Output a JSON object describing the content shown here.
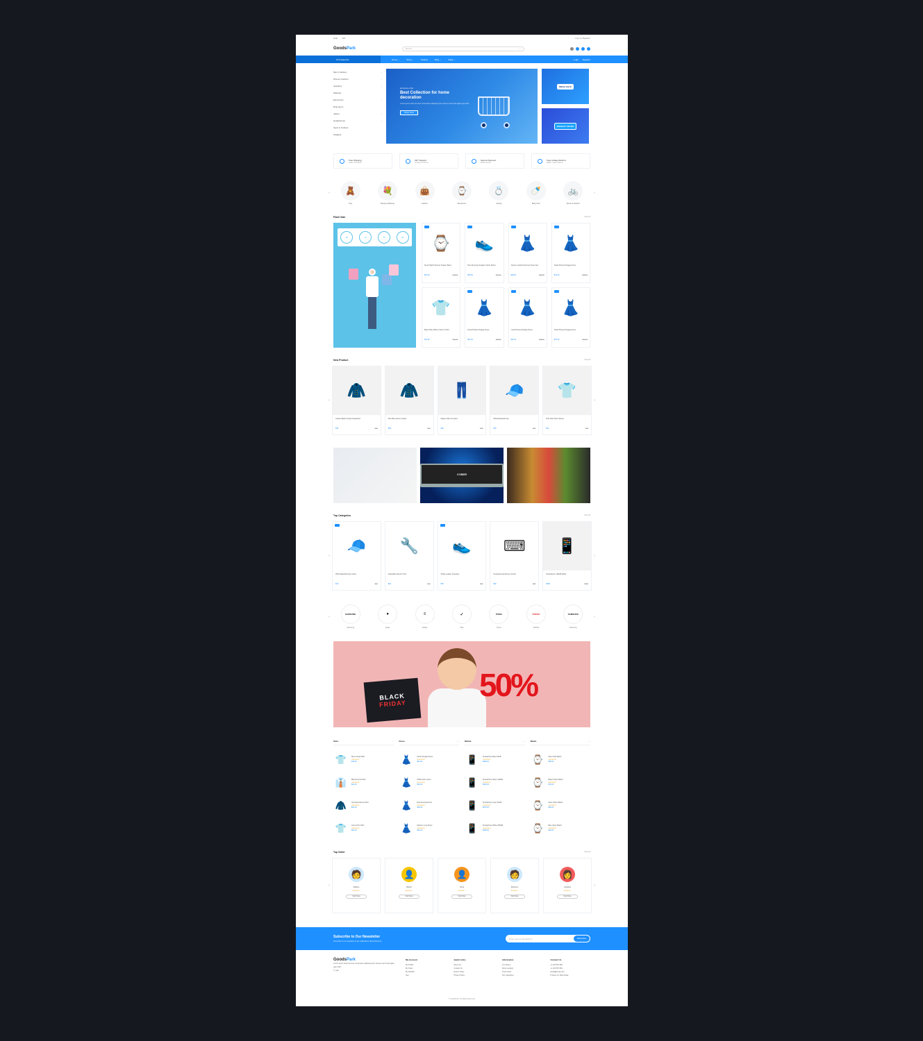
{
  "topbar": {
    "left": [
      "Help",
      "EN"
    ],
    "right": "Log In | Register"
  },
  "header": {
    "logo_a": "Goods",
    "logo_b": "Park",
    "search_placeholder": "Search"
  },
  "nav": {
    "all_categories": "All Categories",
    "links": [
      "Home ⌄",
      "Shop ⌄",
      "Product",
      "Blog ⌄",
      "Page ⌄"
    ],
    "right": [
      "Login",
      "Register"
    ]
  },
  "sidebar_categories": [
    "Men's Fashion",
    "Women Fashion",
    "Jewellery",
    "Watches",
    "Electronics",
    "Ring Items",
    "Jacket",
    "Headphones",
    "Sport & Outdoor",
    "Gadgets"
  ],
  "hero": {
    "small": "Exclusive offer",
    "title": "Best Collection for home decoration",
    "desc": "Lorem ipsum dolor sit amet consectetur adipiscing elit. Aenean commodo ligula eget dolor.",
    "button": "Shop Now",
    "side1": "MEGA SALE",
    "side2": "BIGGEST OFFER"
  },
  "features": [
    {
      "t": "Free Shipping",
      "s": "Order over $100"
    },
    {
      "t": "24/7 Support",
      "s": "Contact us 24 hrs"
    },
    {
      "t": "Secure Payment",
      "s": "100% secure"
    },
    {
      "t": "Free & Easy Returns",
      "s": "Within 7 days returns"
    }
  ],
  "categories": [
    {
      "icon": "🧸",
      "label": "Toys"
    },
    {
      "icon": "💐",
      "label": "Beauty & Makeup"
    },
    {
      "icon": "👜",
      "label": "Fashion"
    },
    {
      "icon": "⌚",
      "label": "Electronics"
    },
    {
      "icon": "💍",
      "label": "Jewelry"
    },
    {
      "icon": "🍼",
      "label": "Baby Care"
    },
    {
      "icon": "🚲",
      "label": "Sports & Outdoor"
    }
  ],
  "flash": {
    "title": "Flash Sale",
    "more": "View All",
    "timer": [
      "00",
      "12",
      "45",
      "30"
    ],
    "products": [
      {
        "icon": "⌚",
        "name": "Smart Watch Fitness Tracker Band",
        "price": "$23.00",
        "old": "$27.00"
      },
      {
        "icon": "👟",
        "name": "Men Running Sneakers Sport Shoes",
        "price": "$36.00",
        "old": "$42.00"
      },
      {
        "icon": "👗",
        "name": "Women Colorful Summer Dress Set",
        "price": "$28.00",
        "old": "$35.00"
      },
      {
        "icon": "👗",
        "name": "Floral Printed Vintage Dress",
        "price": "$31.00",
        "old": "$38.00"
      },
      {
        "icon": "👕",
        "name": "Basic Plain White Cotton T-Shirt",
        "price": "$12.00",
        "old": "$16.00"
      },
      {
        "icon": "👗",
        "name": "Floral Printed Vintage Dress",
        "price": "$31.00",
        "old": "$38.00"
      },
      {
        "icon": "👗",
        "name": "Floral Printed Vintage Dress",
        "price": "$31.00",
        "old": "$38.00"
      },
      {
        "icon": "👗",
        "name": "Floral Printed Vintage Dress",
        "price": "$31.00",
        "old": "$38.00"
      }
    ]
  },
  "new_products": {
    "title": "New Product",
    "more": "View All",
    "items": [
      {
        "icon": "🧥",
        "name": "Classic Black Hoodie Sweatshirt",
        "price": "$45",
        "old": "$52"
      },
      {
        "icon": "🧥",
        "name": "Men Blue Denim Jacket",
        "price": "$58",
        "old": "$66"
      },
      {
        "icon": "👖",
        "name": "Ripped Slim Fit Jeans",
        "price": "$40",
        "old": "$48"
      },
      {
        "icon": "🧢",
        "name": "White Baseball Cap",
        "price": "$15",
        "old": "$19"
      },
      {
        "icon": "👕",
        "name": "Polo Shirt Short Sleeve",
        "price": "$22",
        "old": "$28"
      }
    ]
  },
  "promos": {
    "p2_text": "CYBER"
  },
  "top_categories": {
    "title": "Top Categories",
    "more": "View All",
    "items": [
      {
        "icon": "🧢",
        "name": "White Baseball Cap Unisex",
        "price": "$15",
        "old": "$19"
      },
      {
        "icon": "🔧",
        "name": "Adjustable Wrench Tool",
        "price": "$18",
        "old": "$22"
      },
      {
        "icon": "👟",
        "name": "White Leather Sneakers",
        "price": "$54",
        "old": "$60"
      },
      {
        "icon": "⌨",
        "name": "Keyboard and Mouse Combo",
        "price": "$29",
        "old": "$35"
      },
      {
        "icon": "📱",
        "name": "Smartphone 128GB White",
        "price": "$399",
        "old": "$450"
      }
    ]
  },
  "brands": [
    {
      "logo": "SAMSUNG",
      "label": "Samsung"
    },
    {
      "logo": "",
      "label": "Apple"
    },
    {
      "logo": "≡",
      "label": "Adidas"
    },
    {
      "logo": "✓",
      "label": "Nike"
    },
    {
      "logo": "PUMA",
      "label": "Puma"
    },
    {
      "logo": "TOSHIBA",
      "label": "Toshiba"
    },
    {
      "logo": "SAMSUNG",
      "label": "Samsung"
    }
  ],
  "big_promo": {
    "line1": "BLACK",
    "line2": "FRIDAY",
    "pct": "50%"
  },
  "columns": [
    {
      "title": "Shirt",
      "items": [
        {
          "icon": "👕",
          "name": "Men Casual Shirt",
          "price": "$18.00"
        },
        {
          "icon": "👔",
          "name": "Black Formal Shirt",
          "price": "$22.00"
        },
        {
          "icon": "🧥",
          "name": "Checked Flannel Shirt",
          "price": "$24.00"
        },
        {
          "icon": "👕",
          "name": "Camo Print Shirt",
          "price": "$20.00"
        }
      ]
    },
    {
      "title": "Dress",
      "items": [
        {
          "icon": "👗",
          "name": "Floral Vintage Dress",
          "price": "$31.00"
        },
        {
          "icon": "👗",
          "name": "White Party Gown",
          "price": "$45.00"
        },
        {
          "icon": "👗",
          "name": "Red Evening Dress",
          "price": "$39.00"
        },
        {
          "icon": "👗",
          "name": "Maroon Long Dress",
          "price": "$42.00"
        }
      ]
    },
    {
      "title": "Mobile",
      "items": [
        {
          "icon": "📱",
          "name": "Smartphone Blue 64GB",
          "price": "$299.00"
        },
        {
          "icon": "📱",
          "name": "Smartphone Silver 128GB",
          "price": "$349.00"
        },
        {
          "icon": "📱",
          "name": "Smartphone Cyan 64GB",
          "price": "$279.00"
        },
        {
          "icon": "📱",
          "name": "Smartphone White 256GB",
          "price": "$399.00"
        }
      ]
    },
    {
      "title": "Watch",
      "items": [
        {
          "icon": "⌚",
          "name": "Silver Dial Watch",
          "price": "$59.00"
        },
        {
          "icon": "⌚",
          "name": "Black Smart Watch",
          "price": "$79.00"
        },
        {
          "icon": "⌚",
          "name": "Steel Chain Watch",
          "price": "$69.00"
        },
        {
          "icon": "⌚",
          "name": "Blue Sport Watch",
          "price": "$49.00"
        }
      ]
    }
  ],
  "sellers": {
    "title": "Top Seller",
    "more": "View All",
    "visit": "Visit Store",
    "items": [
      {
        "icon": "🧑",
        "bg": "#cde8fb",
        "name": "Mathew"
      },
      {
        "icon": "👤",
        "bg": "#f7c600",
        "name": "Rachel"
      },
      {
        "icon": "👤",
        "bg": "#f7941d",
        "name": "Hena"
      },
      {
        "icon": "🧑",
        "bg": "#cde8fb",
        "name": "Robinson"
      },
      {
        "icon": "👩",
        "bg": "#f25c5c",
        "name": "Angelina"
      }
    ]
  },
  "newsletter": {
    "title": "Subscribe to Our Newsletter",
    "sub": "Subscribe to our newsletter to get notifications about discounts",
    "placeholder": "Enter your email address",
    "button": "Subscribe"
  },
  "footer": {
    "about": "Lorem ipsum dolor sit amet consectetur adipiscing elit. Aenean commodo ligula eget dolor.",
    "cols": [
      {
        "h": "My Account",
        "items": [
          "My Profile",
          "My Order",
          "My Wishlist",
          "Cart"
        ]
      },
      {
        "h": "Quick Links",
        "items": [
          "About Us",
          "Contact Us",
          "Return Policy",
          "Privacy Policy"
        ]
      },
      {
        "h": "Information",
        "items": [
          "Our Stores",
          "Store Location",
          "Track Order",
          "Top Categories"
        ]
      },
      {
        "h": "Contact Us",
        "items": [
          "+1 234 567 890",
          "+1 234 567 891",
          "Email@email.com",
          "8 Street 12, Main Road"
        ]
      }
    ],
    "copyright": "© GoodsPark. All Rights Reserved."
  },
  "colors": {
    "accent": "#1e90ff",
    "dark": "#15181f"
  }
}
